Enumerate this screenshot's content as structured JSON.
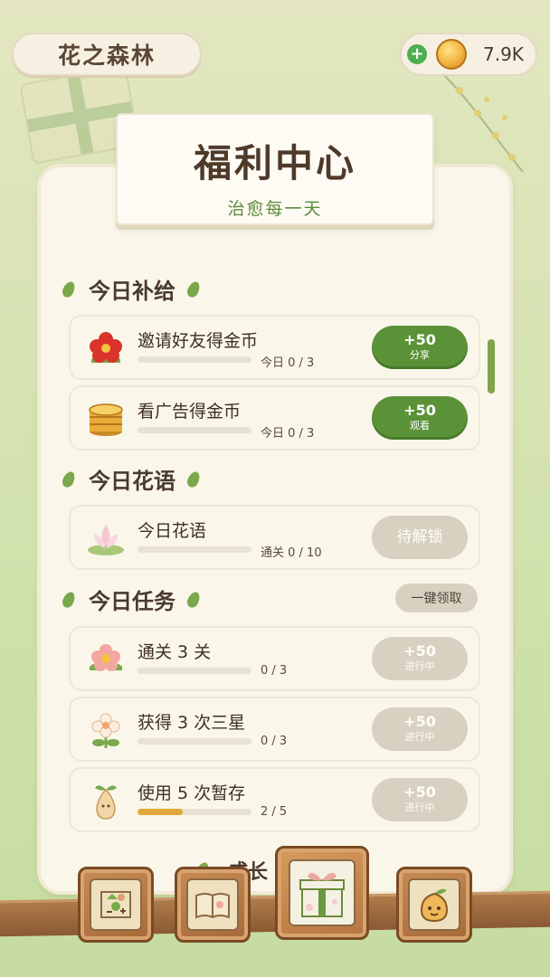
{
  "app": {
    "title": "花之森林",
    "coins": "7.9K",
    "icons": {
      "add": "plus-icon",
      "coin": "coin-icon"
    }
  },
  "header": {
    "title": "福利中心",
    "subtitle": "治愈每一天"
  },
  "sections": {
    "daily_supply": "今日补给",
    "daily_flower_words": "今日花语",
    "daily_tasks": "今日任务",
    "growth": "成长"
  },
  "claim_all": "一键领取",
  "supply_tasks": [
    {
      "name": "邀请好友得金币",
      "progress_text": "今日 0 / 3",
      "progress": 0,
      "btn_main": "+50",
      "btn_sub": "分享",
      "icon": "red-flower-icon"
    },
    {
      "name": "看广告得金币",
      "progress_text": "今日 0 / 3",
      "progress": 0,
      "btn_main": "+50",
      "btn_sub": "观看",
      "icon": "coin-stack-icon"
    }
  ],
  "flower_word_task": {
    "name": "今日花语",
    "progress_text": "通关 0 / 10",
    "progress": 0,
    "btn_main": "待解锁",
    "icon": "lotus-icon"
  },
  "daily_tasks": [
    {
      "name": "通关 3 关",
      "progress_text": "0 / 3",
      "progress": 0,
      "btn_main": "+50",
      "btn_sub": "进行中",
      "icon": "pink-flower-icon"
    },
    {
      "name": "获得 3 次三星",
      "progress_text": "0 / 3",
      "progress": 0,
      "btn_main": "+50",
      "btn_sub": "进行中",
      "icon": "flower-bunch-icon"
    },
    {
      "name": "使用 5 次暂存",
      "progress_text": "2 / 5",
      "progress": 0.4,
      "btn_main": "+50",
      "btn_sub": "进行中",
      "icon": "pear-seed-icon"
    }
  ],
  "nav": [
    {
      "icon": "map-icon"
    },
    {
      "icon": "book-icon"
    },
    {
      "icon": "gift-box-icon",
      "active": true
    },
    {
      "icon": "seed-face-icon"
    }
  ],
  "colors": {
    "accent_green": "#5b9238",
    "progress": "#e0a83a",
    "panel": "#faf6ea"
  }
}
